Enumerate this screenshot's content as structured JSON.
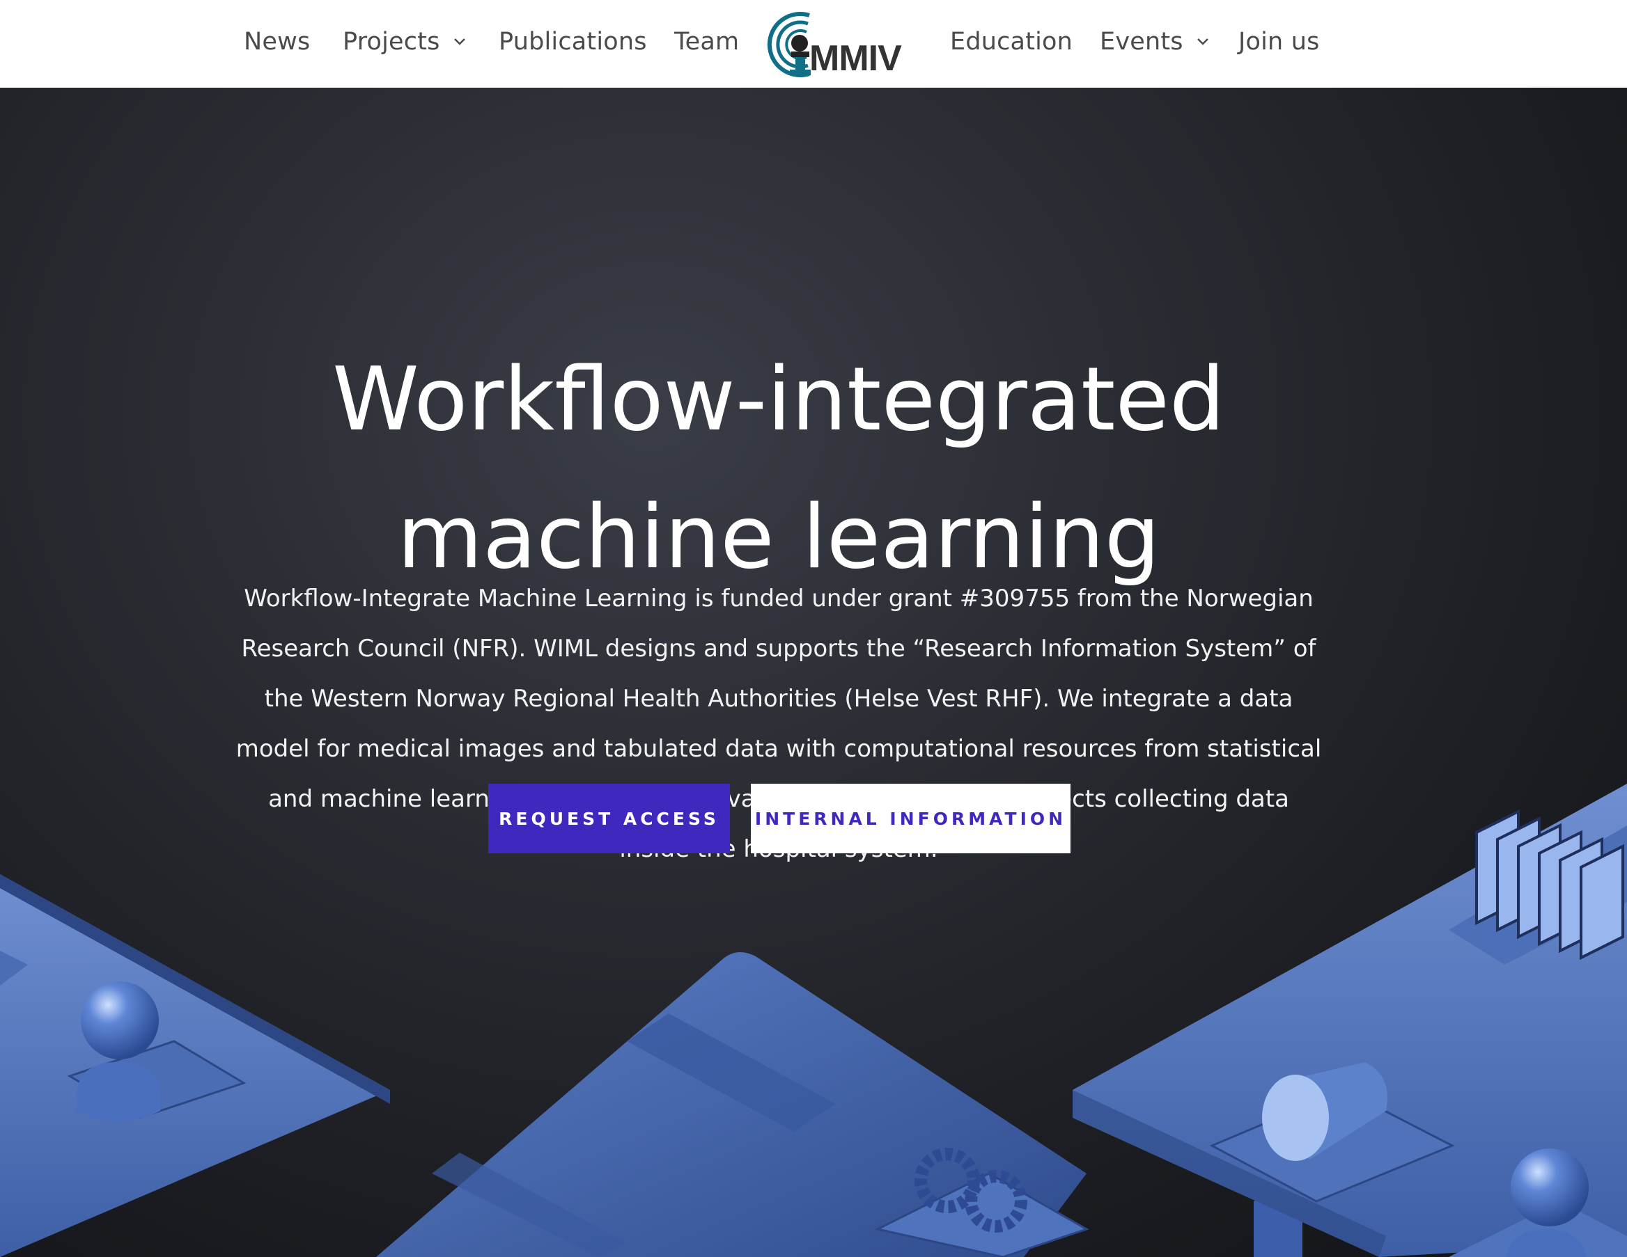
{
  "nav": {
    "items": [
      {
        "label": "News"
      },
      {
        "label": "Projects"
      },
      {
        "label": "Publications"
      },
      {
        "label": "Team"
      },
      {
        "label": "Education"
      },
      {
        "label": "Events"
      },
      {
        "label": "Join us"
      }
    ],
    "logo_text": "MMIV",
    "dropdown_icons": [
      "chevron-down-icon",
      "chevron-down-icon"
    ]
  },
  "hero": {
    "title_line1": "Workflow-integrated",
    "title_line2": "machine learning",
    "description": "Workflow-Integrate Machine Learning is funded under grant #309755 from the Norwegian Research Council (NFR). WIML designs and supports the “Research Information System” of the Western Norway Regional Health Authorities (Helse Vest RHF). We integrate a data model for medical images and tabulated data with computational resources from statistical and machine learning. The system is available for all research projects collecting data inside the hospital system.",
    "buttons": {
      "request_access": "REQUEST ACCESS",
      "internal_information": "INTERNAL INFORMATION"
    }
  },
  "colors": {
    "accent": "#3f28be",
    "hero_background": "#1f2127",
    "illustration_blue": "#4a6fb5",
    "logo_teal": "#0e6f86"
  }
}
